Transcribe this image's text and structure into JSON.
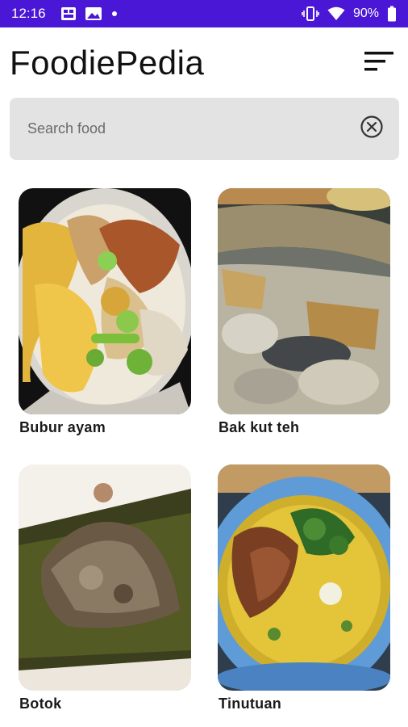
{
  "status_bar": {
    "time": "12:16",
    "battery_percent": "90%",
    "background_color": "#4b17d6",
    "icons": [
      "sim-card-icon",
      "photo-icon",
      "notification-dot-icon",
      "vibrate-icon",
      "wifi-icon",
      "battery-icon"
    ]
  },
  "header": {
    "title": "FoodiePedia",
    "sort_icon": "sort-lines-icon"
  },
  "search": {
    "placeholder": "Search food",
    "value": "",
    "clear_icon": "clear-circle-icon"
  },
  "foods": [
    {
      "name": "Bubur ayam"
    },
    {
      "name": "Bak kut teh"
    },
    {
      "name": "Botok"
    },
    {
      "name": "Tinutuan"
    }
  ]
}
